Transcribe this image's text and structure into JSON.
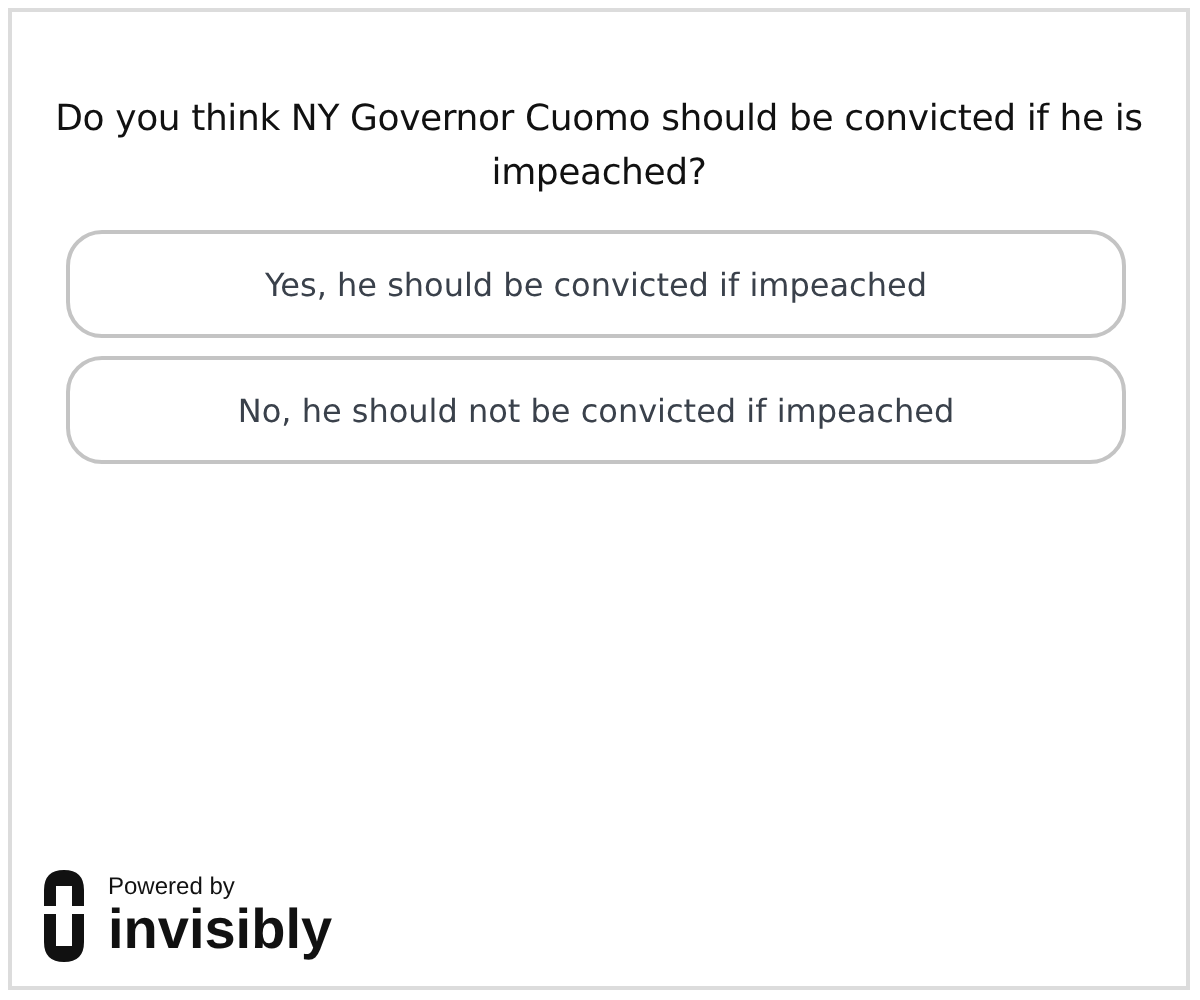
{
  "poll": {
    "question": "Do you think NY Governor Cuomo should be convicted if he is impeached?",
    "options": [
      {
        "label": "Yes, he should be convicted if impeached"
      },
      {
        "label": "No, he should not be convicted if impeached"
      }
    ]
  },
  "footer": {
    "caption": "Powered by",
    "brand": "invisibly"
  }
}
